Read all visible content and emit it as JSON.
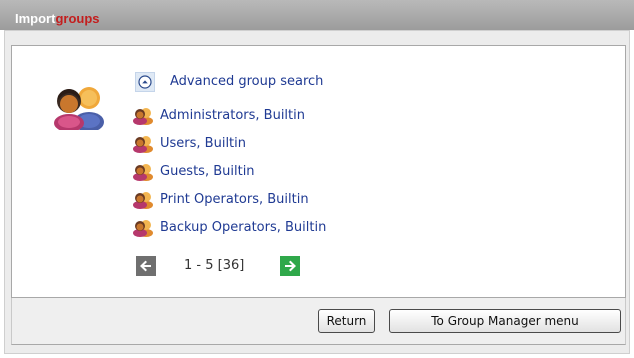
{
  "header": {
    "title_main": "Import",
    "title_accent": "groups",
    "accent_color": "#c31e1e"
  },
  "search": {
    "advanced_label": "Advanced group search",
    "icon": "chevron-up-circle-icon"
  },
  "groups": [
    {
      "label": "Administrators, Builtin",
      "icon": "group-icon"
    },
    {
      "label": "Users, Builtin",
      "icon": "group-icon"
    },
    {
      "label": "Guests, Builtin",
      "icon": "group-icon"
    },
    {
      "label": "Print Operators, Builtin",
      "icon": "group-icon"
    },
    {
      "label": "Backup Operators, Builtin",
      "icon": "group-icon"
    }
  ],
  "pager": {
    "range_text": "1 - 5 [36]",
    "prev_icon": "arrow-left-icon",
    "next_icon": "arrow-right-icon"
  },
  "footer": {
    "return_label": "Return",
    "group_manager_label": "To Group Manager menu"
  }
}
